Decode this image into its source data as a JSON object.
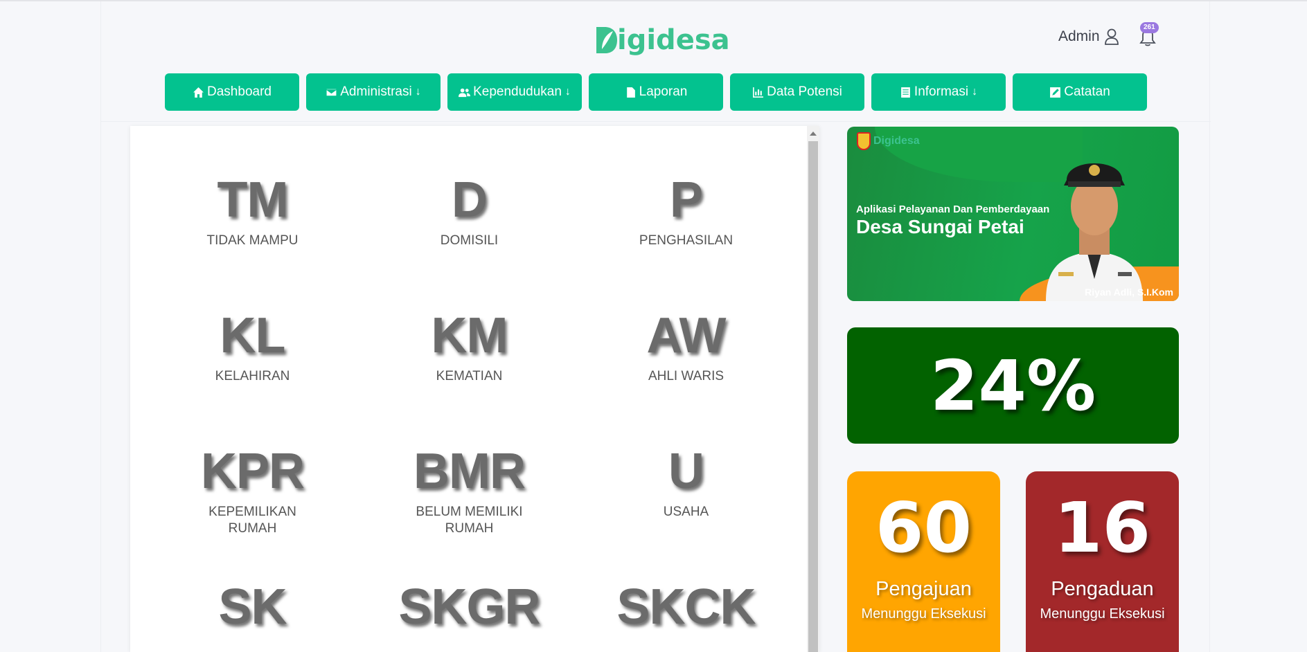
{
  "brand": {
    "logo_text": "igidesa",
    "accent": "#03c28f"
  },
  "user": {
    "name": "Admin",
    "notifications_count": "261"
  },
  "nav": [
    {
      "label": "Dashboard",
      "icon": "home-icon",
      "dropdown": ""
    },
    {
      "label": "Administrasi",
      "icon": "envelope-icon",
      "dropdown": "↓"
    },
    {
      "label": "Kependudukan",
      "icon": "users-icon",
      "dropdown": "↓"
    },
    {
      "label": "Laporan",
      "icon": "file-icon",
      "dropdown": ""
    },
    {
      "label": "Data Potensi",
      "icon": "bar-chart-icon",
      "dropdown": ""
    },
    {
      "label": "Informasi",
      "icon": "list-icon",
      "dropdown": "↓"
    },
    {
      "label": "Catatan",
      "icon": "edit-icon",
      "dropdown": ""
    }
  ],
  "services": [
    {
      "code": "TM",
      "name": "TIDAK MAMPU"
    },
    {
      "code": "D",
      "name": "DOMISILI"
    },
    {
      "code": "P",
      "name": "PENGHASILAN"
    },
    {
      "code": "KL",
      "name": "KELAHIRAN"
    },
    {
      "code": "KM",
      "name": "KEMATIAN"
    },
    {
      "code": "AW",
      "name": "AHLI WARIS"
    },
    {
      "code": "KPR",
      "name": "KEPEMILIKAN RUMAH"
    },
    {
      "code": "BMR",
      "name": "BELUM MEMILIKI RUMAH"
    },
    {
      "code": "U",
      "name": "USAHA"
    },
    {
      "code": "SK",
      "name": ""
    },
    {
      "code": "SKGR",
      "name": ""
    },
    {
      "code": "SKCK",
      "name": ""
    }
  ],
  "banner": {
    "brand": "Digidesa",
    "subtitle": "Aplikasi Pelayanan Dan Pemberdayaan",
    "title": "Desa Sungai Petai",
    "person_name": "Riyan Adli, S.I.Kom"
  },
  "progress": {
    "value": "24%",
    "color": "#026200"
  },
  "stats": {
    "pengajuan": {
      "count": "60",
      "label": "Pengajuan",
      "sublabel": "Menunggu Eksekusi",
      "color": "#ffa501"
    },
    "pengaduan": {
      "count": "16",
      "label": "Pengaduan",
      "sublabel": "Menunggu Eksekusi",
      "color": "#a3282a"
    }
  }
}
